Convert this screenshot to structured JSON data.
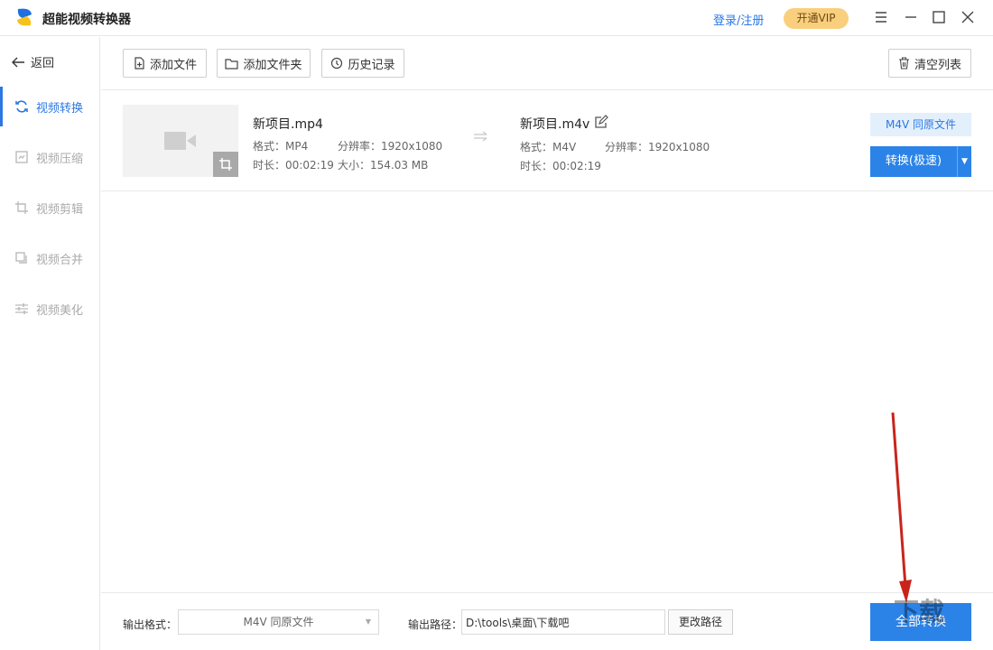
{
  "app": {
    "title": "超能视频转换器",
    "login": "登录/注册",
    "vip": "开通VIP"
  },
  "sidebar": {
    "back": "返回",
    "items": [
      {
        "label": "视频转换",
        "active": true
      },
      {
        "label": "视频压缩"
      },
      {
        "label": "视频剪辑"
      },
      {
        "label": "视频合并"
      },
      {
        "label": "视频美化"
      }
    ]
  },
  "toolbar": {
    "add_file": "添加文件",
    "add_folder": "添加文件夹",
    "history": "历史记录",
    "clear": "清空列表"
  },
  "file": {
    "source": {
      "name": "新项目.mp4",
      "format": "格式：MP4",
      "resolution": "分辨率：1920x1080",
      "duration": "时长：00:02:19",
      "size": "大小：154.03 MB"
    },
    "target": {
      "name": "新项目.m4v",
      "format": "格式：M4V",
      "resolution": "分辨率：1920x1080",
      "duration": "时长：00:02:19"
    },
    "format_tag": "M4V 同原文件",
    "convert": "转换(极速)"
  },
  "bottom": {
    "format_label": "输出格式：",
    "format_value": "M4V 同原文件",
    "path_label": "输出路径：",
    "path_value": "D:\\tools\\桌面\\下载吧",
    "change_path": "更改路径",
    "convert_all": "全部转换"
  },
  "colors": {
    "accent": "#2b83e8",
    "vip": "#f9cf7e",
    "annotation": "#d0241b"
  }
}
